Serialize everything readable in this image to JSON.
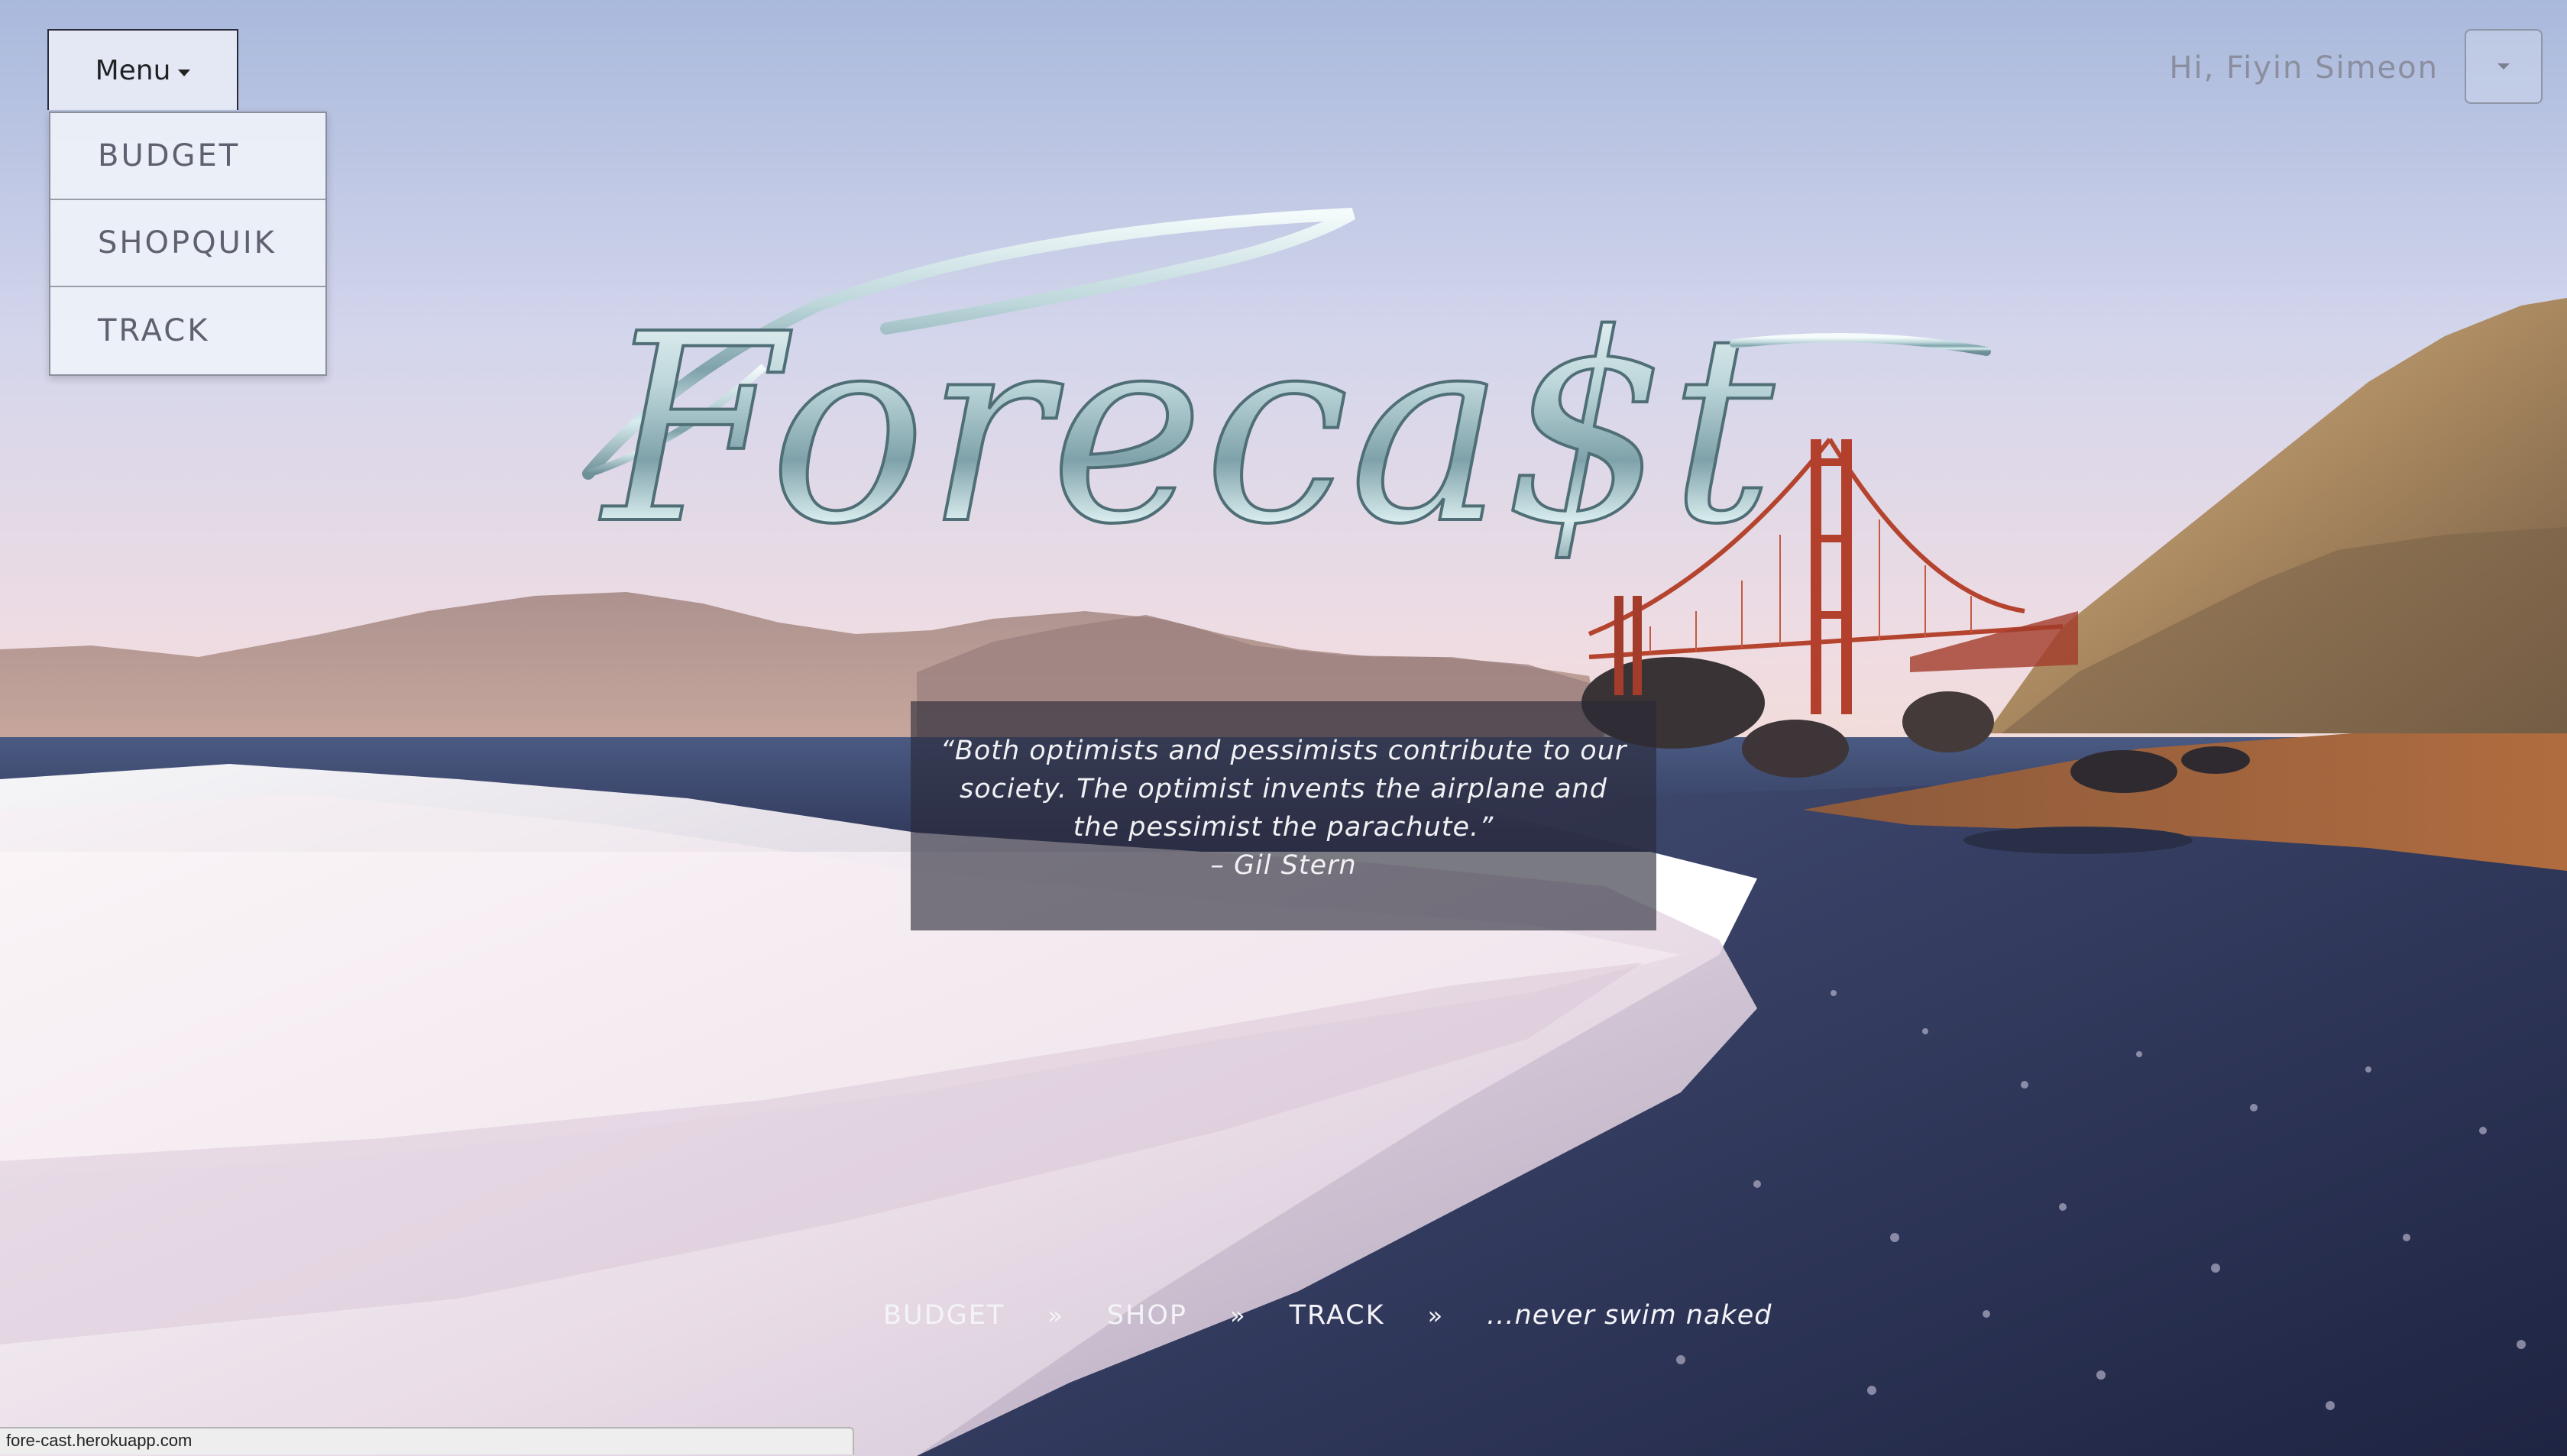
{
  "menu": {
    "toggle_label": "Menu",
    "items": [
      {
        "label": "BUDGET"
      },
      {
        "label": "SHOPQUIK"
      },
      {
        "label": "TRACK"
      }
    ]
  },
  "user": {
    "greeting": "Hi, Fiyin Simeon"
  },
  "logo": {
    "text": "Foreca$t"
  },
  "quote": {
    "text": "“Both optimists and pessimists contribute to our society. The optimist invents the airplane and the pessimist the parachute.”",
    "author": "– Gil Stern"
  },
  "footer_nav": {
    "items": [
      "BUDGET",
      "SHOP",
      "TRACK"
    ],
    "separator": "»",
    "tagline": "...never swim naked"
  },
  "status_bar": {
    "url": "fore-cast.herokuapp.com"
  },
  "colors": {
    "sky_top": "#b8c4e2",
    "sky_bottom": "#e9dbe3",
    "sand": "#a4663e",
    "water_dark": "#2c3155",
    "bridge": "#b5442f",
    "logo_silver": "#c9dde0"
  }
}
